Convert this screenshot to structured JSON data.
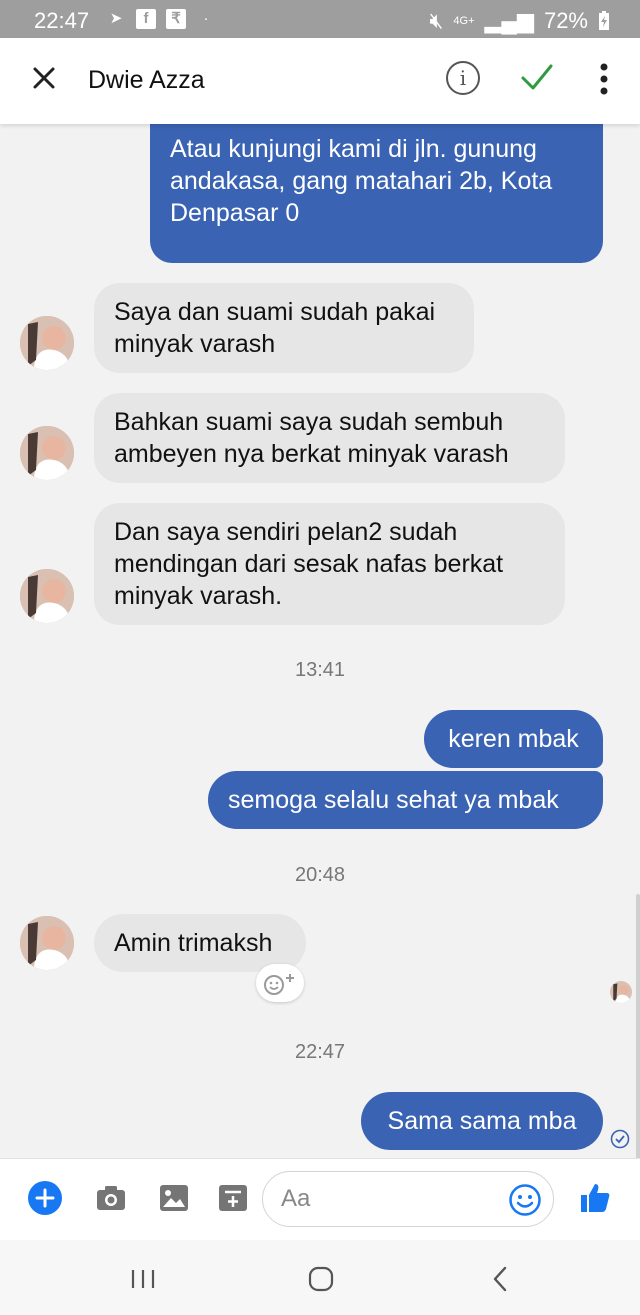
{
  "status_bar": {
    "time": "22:47",
    "network": "4G+",
    "battery": "72%"
  },
  "header": {
    "contact_name": "Dwie Azza"
  },
  "messages": [
    {
      "lines": [
        "Atau kunjungi kami di jln. gunung",
        "andakasa, gang matahari 2b, Kota",
        "Denpasar 0"
      ]
    },
    {
      "lines": [
        "Saya dan suami sudah pakai",
        "minyak varash"
      ]
    },
    {
      "lines": [
        "Bahkan suami saya sudah sembuh",
        "ambeyen nya berkat minyak varash"
      ]
    },
    {
      "lines": [
        "Dan saya sendiri pelan2 sudah",
        "mendingan dari sesak nafas berkat",
        "minyak varash."
      ]
    },
    {
      "text": "keren mbak"
    },
    {
      "text": "semoga selalu sehat ya mbak"
    },
    {
      "text": "Amin trimaksh"
    },
    {
      "text": "Sama sama mba"
    }
  ],
  "timestamps": [
    "13:41",
    "20:48",
    "22:47"
  ],
  "composer": {
    "placeholder": "Aa"
  },
  "colors": {
    "outgoing_bubble": "#3a63b3",
    "incoming_bubble": "#e6e6e6",
    "accent": "#1877f2",
    "check": "#2e9b3f"
  }
}
